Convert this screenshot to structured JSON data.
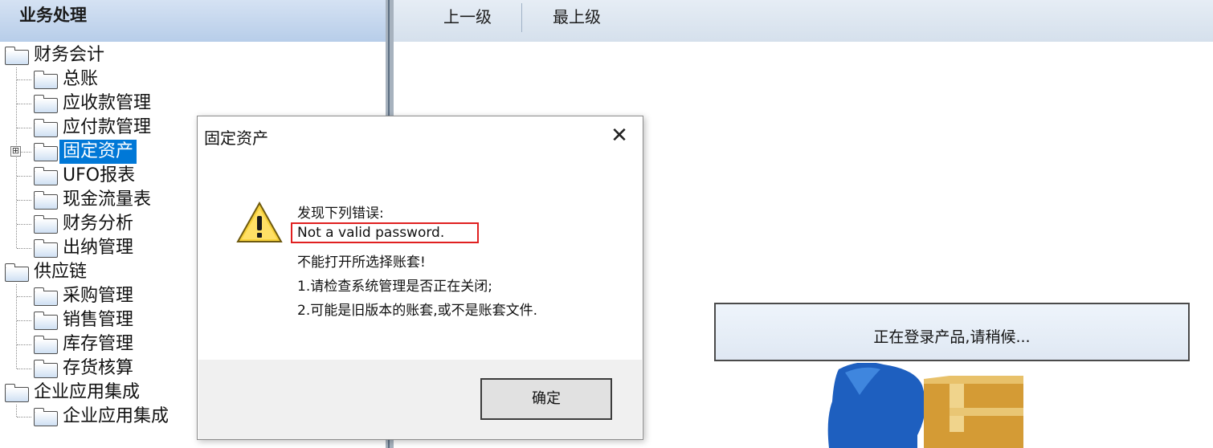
{
  "left_panel": {
    "title": "业务处理",
    "tree": [
      {
        "label": "财务会计",
        "level": 0
      },
      {
        "label": "总账",
        "level": 1
      },
      {
        "label": "应收款管理",
        "level": 1
      },
      {
        "label": "应付款管理",
        "level": 1
      },
      {
        "label": "固定资产",
        "level": 1,
        "selected": true,
        "expander": "⊞"
      },
      {
        "label": "UFO报表",
        "level": 1
      },
      {
        "label": "现金流量表",
        "level": 1
      },
      {
        "label": "财务分析",
        "level": 1
      },
      {
        "label": "出纳管理",
        "level": 1
      },
      {
        "label": "供应链",
        "level": 0
      },
      {
        "label": "采购管理",
        "level": 1
      },
      {
        "label": "销售管理",
        "level": 1
      },
      {
        "label": "库存管理",
        "level": 1
      },
      {
        "label": "存货核算",
        "level": 1
      },
      {
        "label": "企业应用集成",
        "level": 0
      },
      {
        "label": "企业应用集成",
        "level": 1
      }
    ]
  },
  "toolbar": {
    "up_label": "上一级",
    "top_label": "最上级"
  },
  "login_status": "正在登录产品,请稍候...",
  "dialog": {
    "title": "固定资产",
    "close_symbol": "✕",
    "icon": "warning-icon",
    "messages": [
      "发现下列错误:",
      "Not a valid password.",
      "不能打开所选择账套!",
      "1.请检查系统管理是否正在关闭;",
      "2.可能是旧版本的账套,或不是账套文件."
    ],
    "ok_label": "确定"
  },
  "colors": {
    "selection": "#0078d7",
    "highlight_border": "#e02020",
    "header_gradient_top": "#d5e2f3",
    "header_gradient_bottom": "#b7cde9"
  }
}
